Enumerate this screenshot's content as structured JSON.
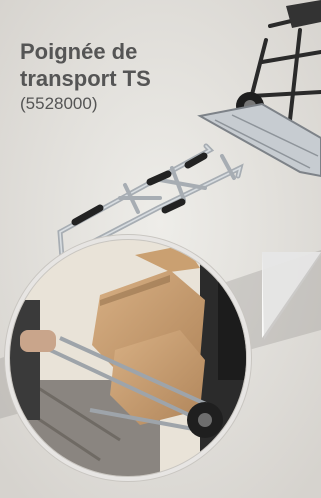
{
  "product": {
    "title_line1": "Poignée de",
    "title_line2": "transport TS",
    "code": "(5528000)"
  },
  "colors": {
    "background": "#e4e2de",
    "text": "#555555",
    "metal": "#a7adb3",
    "grip": "#222222",
    "box": "#c49a68"
  },
  "icons": [
    "hand-truck-illustration",
    "handle-illustration",
    "photo-circle"
  ]
}
